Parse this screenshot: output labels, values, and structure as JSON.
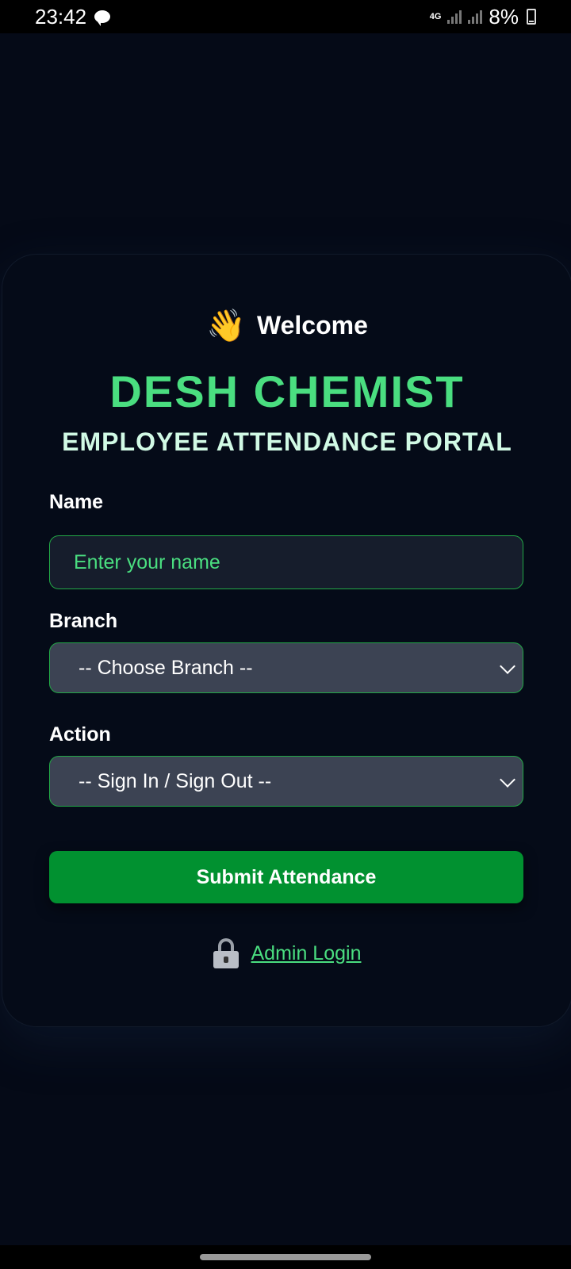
{
  "status_bar": {
    "time": "23:42",
    "network": "4G",
    "battery": "8%"
  },
  "card": {
    "welcome_emoji": "👋",
    "welcome_text": "Welcome",
    "brand": "DESH CHEMIST",
    "subtitle": "EMPLOYEE ATTENDANCE PORTAL",
    "name_label": "Name",
    "name_placeholder": "Enter your name",
    "branch_label": "Branch",
    "branch_value": "-- Choose Branch --",
    "action_label": "Action",
    "action_value": "-- Sign In / Sign Out --",
    "submit_label": "Submit Attendance",
    "admin_link": "Admin Login"
  },
  "colors": {
    "background": "#050a17",
    "accent_green": "#4ade80",
    "button_green": "#019130",
    "select_bg": "#3c4353"
  },
  "icons": {
    "chat": "chat-bubble-icon",
    "wave": "waving-hand-icon",
    "lock": "lock-icon",
    "chevron": "chevron-down-icon"
  }
}
